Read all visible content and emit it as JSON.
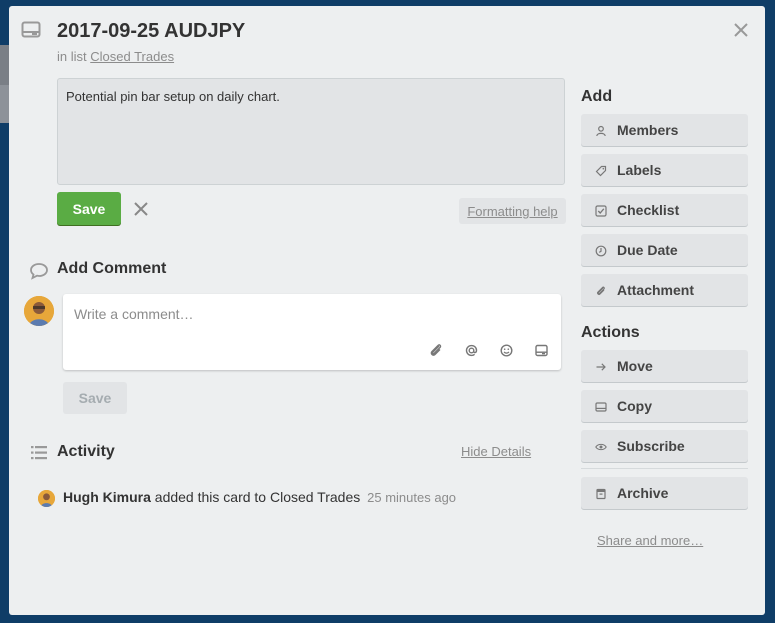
{
  "card": {
    "title": "2017-09-25 AUDJPY",
    "in_list_prefix": "in list",
    "list_name": "Closed Trades",
    "description": "Potential pin bar setup on daily chart."
  },
  "description_editor": {
    "save_label": "Save",
    "formatting_help": "Formatting help"
  },
  "comment": {
    "heading": "Add Comment",
    "placeholder": "Write a comment…",
    "save_label": "Save",
    "toolbar_icons": [
      "attachment-icon",
      "mention-icon",
      "emoji-icon",
      "card-icon"
    ]
  },
  "activity": {
    "heading": "Activity",
    "hide_details": "Hide Details",
    "items": [
      {
        "user": "Hugh Kimura",
        "action": "added this card to Closed Trades",
        "time": "25 minutes ago"
      }
    ]
  },
  "sidebar": {
    "add_heading": "Add",
    "add_buttons": [
      {
        "label": "Members",
        "icon": "person-icon"
      },
      {
        "label": "Labels",
        "icon": "tag-icon"
      },
      {
        "label": "Checklist",
        "icon": "checkbox-icon"
      },
      {
        "label": "Due Date",
        "icon": "clock-icon"
      },
      {
        "label": "Attachment",
        "icon": "paperclip-icon"
      }
    ],
    "actions_heading": "Actions",
    "action_buttons": [
      {
        "label": "Move",
        "icon": "arrow-right-icon"
      },
      {
        "label": "Copy",
        "icon": "card-icon"
      },
      {
        "label": "Subscribe",
        "icon": "eye-icon"
      },
      {
        "label": "Archive",
        "icon": "archive-icon"
      }
    ],
    "share_more": "Share and more…"
  },
  "colors": {
    "background": "#0f3d67",
    "modal": "#edeff0",
    "save_green": "#5aac44",
    "button_gray": "#e2e4e6"
  }
}
